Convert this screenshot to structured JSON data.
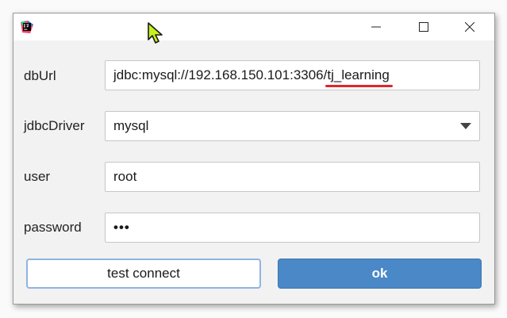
{
  "window": {
    "app_icon": "intellij-idea-icon",
    "controls": {
      "minimize_icon": "minimize-icon",
      "maximize_icon": "maximize-icon",
      "close_icon": "close-icon"
    }
  },
  "form": {
    "db_url": {
      "label": "dbUrl",
      "value_prefix": "jdbc:mysql://192.168.150.101:3306/",
      "value_flagged": "tj_learning"
    },
    "jdbc_driver": {
      "label": "jdbcDriver",
      "selected": "mysql"
    },
    "user": {
      "label": "user",
      "value": "root"
    },
    "password": {
      "label": "password",
      "masked_value": "•••"
    }
  },
  "buttons": {
    "test_connect": "test connect",
    "ok": "ok"
  },
  "colors": {
    "ok_button": "#4a88c7",
    "focus_border": "#8fb4e0",
    "spellcheck_underline": "#e0242c"
  }
}
